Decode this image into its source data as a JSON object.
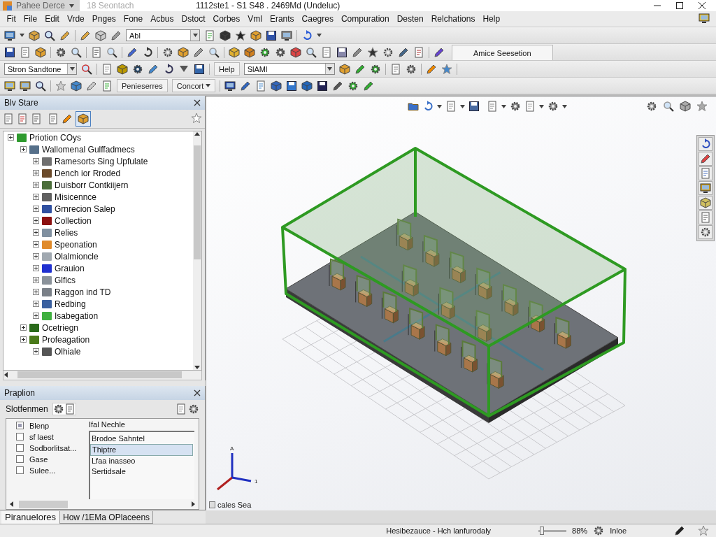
{
  "title_bar": {
    "app_menu": "Pahee Derce",
    "search": "18 Seontach",
    "title": "1112ste1 - S1 S48 . 2469Md (Undeluc)"
  },
  "menu": [
    "Fit",
    "File",
    "Edit",
    "Vrde",
    "Pnges",
    "Fone",
    "Acbus",
    "Dstoct",
    "Corbes",
    "Vml",
    "Erants",
    "Caegres",
    "Compuration",
    "Desten",
    "Relchations",
    "Help"
  ],
  "toolbars": {
    "row1_combo": "Abl",
    "row2_tab": "Amice Seesetion",
    "row3_combo_1": "Stron Sandtone",
    "row3_button": "Help",
    "row3_combo_2": "SlAMl",
    "row4_buttons": [
      "Penieserres",
      "Concort"
    ]
  },
  "tree_panel": {
    "title": "Blv Stare",
    "tree": [
      {
        "label": "Priotion COys",
        "color": "#2e9a2e",
        "children": [
          {
            "label": "Wallomenal Gulffadmecs",
            "color": "#56708a",
            "children": [
              {
                "label": "Ramesorts Sing Upfulate",
                "color": "#707070"
              },
              {
                "label": "Dench ior Rroded",
                "color": "#6b4a2a"
              },
              {
                "label": "Duisborr Contkiijern",
                "color": "#4b6e3a"
              },
              {
                "label": "Misicennce",
                "color": "#606060"
              },
              {
                "label": "Grnrecion Salep",
                "color": "#3050a0"
              },
              {
                "label": "Collection",
                "color": "#8b1010"
              },
              {
                "label": "Relies",
                "color": "#8090a0"
              },
              {
                "label": "Speonation",
                "color": "#e08a2a"
              },
              {
                "label": "Olalmioncle",
                "color": "#a0a8b0"
              },
              {
                "label": "Grauion",
                "color": "#2030d0"
              },
              {
                "label": "Glfics",
                "color": "#8a929a"
              },
              {
                "label": "Raggon ind TD",
                "color": "#7a8088"
              },
              {
                "label": "Redbing",
                "color": "#3a60a0"
              },
              {
                "label": "Isabegation",
                "color": "#40b040"
              }
            ]
          },
          {
            "label": "Ocetriegn",
            "color": "#2a6a1a"
          },
          {
            "label": "Profeagation",
            "color": "#4a7a1a",
            "children": [
              {
                "label": "Olhiale",
                "color": "#555555"
              }
            ]
          }
        ]
      }
    ]
  },
  "properties": {
    "title": "Praplion",
    "filter_label": "Slotfenmen",
    "header": "Ifal Nechle",
    "options": [
      {
        "label": "Blenp",
        "checked": true
      },
      {
        "label": "sf laest",
        "checked": false
      },
      {
        "label": "Sodborlitsat...",
        "checked": false
      },
      {
        "label": "Gase",
        "checked": false
      },
      {
        "label": "Sulee...",
        "checked": false
      }
    ],
    "values": [
      {
        "text": "Brodoe Sahntel",
        "selected": false
      },
      {
        "text": "Thiptre",
        "selected": true
      },
      {
        "text": "Lfaa inasseo",
        "selected": false
      },
      {
        "text": "Sertidsale",
        "selected": false
      }
    ]
  },
  "panel_tabs": [
    {
      "label": "Piranuelores",
      "selected": true
    },
    {
      "label": "How /1EMa OPlaceens",
      "selected": false
    }
  ],
  "viewport": {
    "axis_labels": [
      "A",
      "1"
    ],
    "footer": "cales Sea"
  },
  "status_bar": {
    "text": "Hesibezauce - Hch lanfurodaly",
    "zoom": {
      "level": 0.12
    },
    "zoom_reading": "88%",
    "mode": "Inloe"
  }
}
